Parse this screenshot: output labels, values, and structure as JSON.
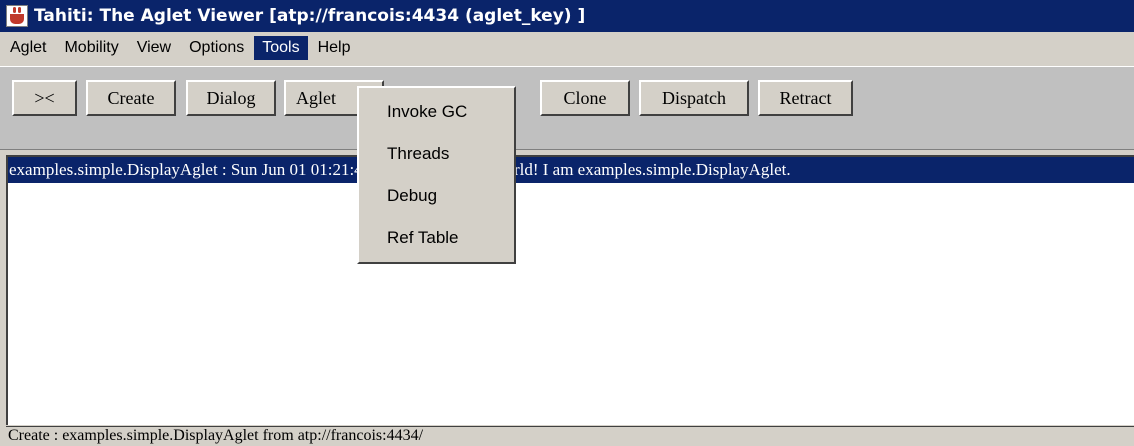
{
  "window": {
    "title": "Tahiti: The Aglet Viewer [atp://francois:4434 (aglet_key) ]"
  },
  "menubar": {
    "items": [
      {
        "label": "Aglet"
      },
      {
        "label": "Mobility"
      },
      {
        "label": "View"
      },
      {
        "label": "Options"
      },
      {
        "label": "Tools"
      },
      {
        "label": "Help"
      }
    ]
  },
  "toolbar": {
    "buttons": [
      {
        "label": "><"
      },
      {
        "label": "Create"
      },
      {
        "label": "Dialog"
      },
      {
        "label": "Aglet"
      },
      {
        "label": "Clone"
      },
      {
        "label": "Dispatch"
      },
      {
        "label": "Retract"
      }
    ]
  },
  "tools_menu": {
    "items": [
      {
        "label": "Invoke GC"
      },
      {
        "label": "Threads"
      },
      {
        "label": "Debug"
      },
      {
        "label": "Ref Table"
      }
    ]
  },
  "messages": {
    "selected_line": "examples.simple.DisplayAglet : Sun Jun 01 01:21:42 PST 2003 Hello, world! I am examples.simple.DisplayAglet."
  },
  "status": {
    "text": "Create : examples.simple.DisplayAglet from atp://francois:4434/"
  }
}
